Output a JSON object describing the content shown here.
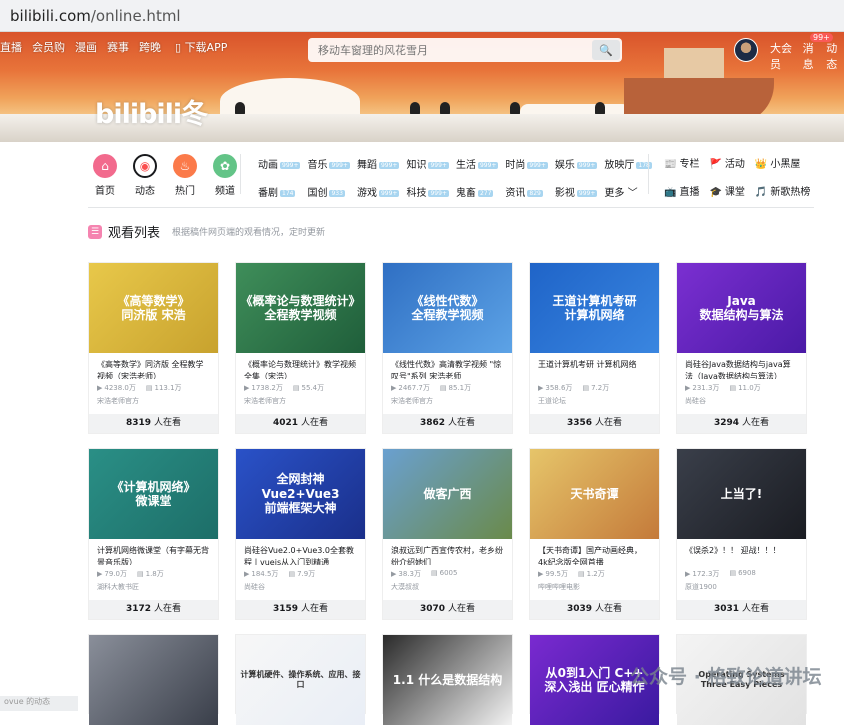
{
  "url": {
    "domain": "bilibili.com",
    "path": "/online.html"
  },
  "nav": {
    "items": [
      "直播",
      "会员购",
      "漫画",
      "赛事",
      "跨晚"
    ],
    "download": "下载APP",
    "search_placeholder": "移动车窗理的风花雪月",
    "right": [
      "大会员",
      "消息",
      "动态"
    ],
    "msg_badge": "99+"
  },
  "logo": "bilibili冬",
  "main_icons": [
    {
      "label": "首页",
      "color": "#f26a8d",
      "glyph": "⌂"
    },
    {
      "label": "动态",
      "color": "#ffffff",
      "glyph": "◉"
    },
    {
      "label": "热门",
      "color": "#fb7a4a",
      "glyph": "♨"
    },
    {
      "label": "频道",
      "color": "#63c487",
      "glyph": "✿"
    }
  ],
  "categories": [
    {
      "name": "动画",
      "n": "999+"
    },
    {
      "name": "音乐",
      "n": "999+"
    },
    {
      "name": "舞蹈",
      "n": "999+"
    },
    {
      "name": "知识",
      "n": "999+"
    },
    {
      "name": "生活",
      "n": "999+"
    },
    {
      "name": "时尚",
      "n": "999+"
    },
    {
      "name": "娱乐",
      "n": "999+"
    },
    {
      "name": "番剧",
      "n": "174"
    },
    {
      "name": "国创",
      "n": "933"
    },
    {
      "name": "游戏",
      "n": "999+"
    },
    {
      "name": "科技",
      "n": "999+"
    },
    {
      "name": "鬼畜",
      "n": "277"
    },
    {
      "name": "资讯",
      "n": "829"
    },
    {
      "name": "影视",
      "n": "999+"
    }
  ],
  "categories_extra": {
    "live": "放映厅",
    "live_n": "178",
    "more": "更多"
  },
  "right_links": [
    {
      "label": "专栏",
      "icon": "📰"
    },
    {
      "label": "活动",
      "icon": "🚩"
    },
    {
      "label": "小黑屋",
      "icon": "👑"
    },
    {
      "label": "直播",
      "icon": "📺"
    },
    {
      "label": "课堂",
      "icon": "🎓"
    },
    {
      "label": "新歌热榜",
      "icon": "🎵"
    }
  ],
  "section": {
    "title": "观看列表",
    "subtitle": "根据稿件网页端的观看情况，定时更新",
    "icon": "☰"
  },
  "watching_suffix": "人在看",
  "videos": [
    {
      "thumb": "《高等数学》\n同济版 宋浩",
      "bg": "linear-gradient(135deg,#e8c84a,#c8a22e)",
      "title": "《高等数学》同济版 全程教学视频（宋浩老师）",
      "plays": "4238.0万",
      "danmaku": "113.1万",
      "up": "宋浩老师官方",
      "watching": "8319"
    },
    {
      "thumb": "《概率论与数理统计》\n全程教学视频",
      "bg": "linear-gradient(135deg,#3f8e5a,#1f5e3a)",
      "title": "《概率论与数理统计》教学视频全集（宋浩）",
      "plays": "1738.2万",
      "danmaku": "55.4万",
      "up": "宋浩老师官方",
      "watching": "4021"
    },
    {
      "thumb": "《线性代数》\n全程教学视频",
      "bg": "linear-gradient(135deg,#2f6fc3,#5da3e6)",
      "title": "《线性代数》高清教学视频 \"惊叹号\"系列 宋浩老师",
      "plays": "2467.7万",
      "danmaku": "85.1万",
      "up": "宋浩老师官方",
      "watching": "3862"
    },
    {
      "thumb": "王道计算机考研\n计算机网络",
      "bg": "linear-gradient(135deg,#1f64c8,#3a86e0)",
      "title": "王道计算机考研 计算机网络",
      "plays": "358.6万",
      "danmaku": "7.2万",
      "up": "王道论坛",
      "watching": "3356"
    },
    {
      "thumb": "Java\n数据结构与算法",
      "bg": "linear-gradient(135deg,#7b2fd1,#4a1aa6)",
      "title": "尚硅谷Java数据结构与java算法（Java数据结构与算法）",
      "plays": "231.3万",
      "danmaku": "11.0万",
      "up": "尚硅谷",
      "watching": "3294"
    },
    {
      "thumb": "《计算机网络》\n微课堂",
      "bg": "linear-gradient(135deg,#2a8f86,#1d6e68)",
      "title": "计算机网络微课堂（有字幕无背景音乐版）",
      "plays": "79.0万",
      "danmaku": "1.8万",
      "up": "湖科大教书匠",
      "watching": "3172"
    },
    {
      "thumb": "全网封神\nVue2+Vue3\n前端框架大神",
      "bg": "linear-gradient(135deg,#2a52c8,#1a2f8a)",
      "title": "尚硅谷Vue2.0+Vue3.0全套教程丨vuejs从入门到精通",
      "plays": "184.5万",
      "danmaku": "7.9万",
      "up": "尚硅谷",
      "watching": "3159"
    },
    {
      "thumb": "做客广西",
      "bg": "linear-gradient(135deg,#6aa0d0,#6a8a4a)",
      "title": "浪叔远到广西宣传农村，老乡纷纷介绍她们",
      "plays": "38.3万",
      "danmaku": "6005",
      "up": "大漠叔叔",
      "watching": "3070"
    },
    {
      "thumb": "天书奇谭",
      "bg": "linear-gradient(135deg,#e6c56a,#c47a3a)",
      "title": "【天书奇谭】国产动画经典，4k纪念版全网首播",
      "plays": "99.5万",
      "danmaku": "1.2万",
      "up": "哔哩哔哩电影",
      "watching": "3039"
    },
    {
      "thumb": "上当了!",
      "bg": "linear-gradient(135deg,#3a3f4a,#1a1c22)",
      "title": "《误杀2》！！ 迎战！！！",
      "plays": "172.3万",
      "danmaku": "6908",
      "up": "原道1900",
      "watching": "3031"
    },
    {
      "thumb": "",
      "bg": "linear-gradient(135deg,#8a8f9a,#3a3f4a)"
    },
    {
      "thumb": "计算机硬件、操作系统、应用、接口",
      "bg": "linear-gradient(135deg,#f7f7f7,#e9eef6)"
    },
    {
      "thumb": "1.1 什么是数据结构",
      "bg": "linear-gradient(135deg,#2a2a2a,#f3f3f3)"
    },
    {
      "thumb": "从0到1入门 C++\n深入浅出 匠心精作",
      "bg": "linear-gradient(135deg,#7a2ad0,#3a1aa0)"
    },
    {
      "thumb": "Operating Systems\nThree Easy Pieces",
      "bg": "linear-gradient(135deg,#f4f4f4,#e2e2e2)"
    }
  ],
  "watermark": "公众号 · 格致论道讲坛",
  "corner": "ovue 的动态"
}
